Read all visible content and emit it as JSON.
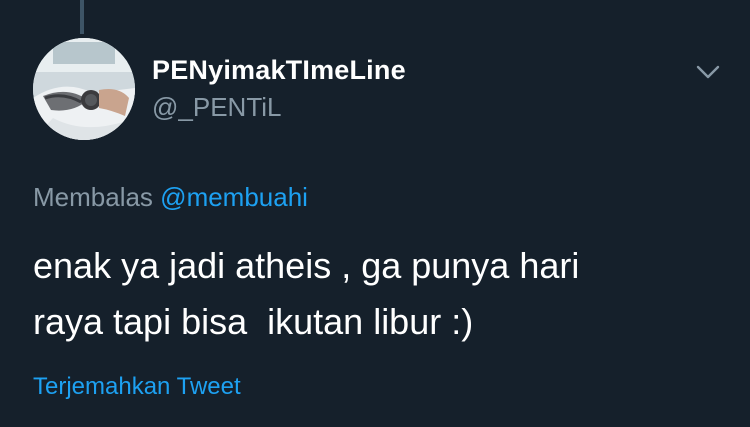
{
  "author": {
    "display_name": "PENyimakTImeLine",
    "handle": "@_PENTiL"
  },
  "reply": {
    "prefix": "Membalas",
    "mention": "@membuahi"
  },
  "tweet": {
    "text": "enak ya jadi atheis , ga punya hari\nraya tapi bisa  ikutan libur :)"
  },
  "actions": {
    "translate_label": "Terjemahkan Tweet"
  },
  "icons": {
    "menu": "chevron-down-icon"
  },
  "colors": {
    "background": "#15202b",
    "primary_text": "#ffffff",
    "secondary_text": "#8899a6",
    "accent": "#1da1f2"
  }
}
